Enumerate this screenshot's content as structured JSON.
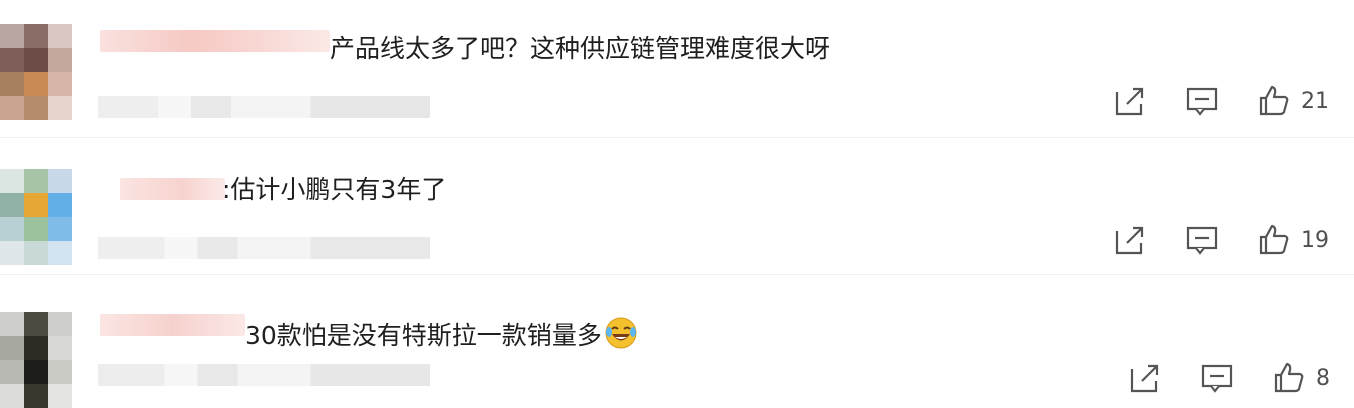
{
  "comments": [
    {
      "text": "产品线太多了吧？这种供应链管理难度很大呀",
      "likes": "21",
      "icons": [
        "share-icon",
        "reply-icon",
        "thumbs-up-icon"
      ],
      "avatar_palette": [
        "#b7a6a0",
        "#8a6d67",
        "#d9c6c2",
        "#7d5e58",
        "#6e4d48",
        "#c4a79d",
        "#a7805d",
        "#c98a55",
        "#d7b6a8",
        "#c9a58f",
        "#b68b6b",
        "#e6d5cd"
      ],
      "name_color": "#f7d2cf"
    },
    {
      "text": ":估计小鹏只有3年了",
      "likes": "19",
      "icons": [
        "share-icon",
        "reply-icon",
        "thumbs-up-icon"
      ],
      "avatar_palette": [
        "#dbe6e3",
        "#a7c5a6",
        "#c7d9e9",
        "#8fb1a6",
        "#e6a734",
        "#63aee6",
        "#b8cfd3",
        "#9cc29d",
        "#7fbde8",
        "#e0e7ea",
        "#c9d9d6",
        "#d2e4f1"
      ],
      "name_color": "#f7dad7"
    },
    {
      "text": "30款怕是没有特斯拉一款销量多",
      "likes": "8",
      "icons": [
        "share-icon",
        "reply-icon",
        "thumbs-up-icon"
      ],
      "emoji": "laughing-tears-emoji",
      "avatar_palette": [
        "#cfcfcb",
        "#4b4b40",
        "#cfcfcb",
        "#a7a8a0",
        "#2b2b24",
        "#d8d8d4",
        "#b9b9b3",
        "#1d1d19",
        "#cbcbc6",
        "#dcdcd8",
        "#38382f",
        "#e4e4e0"
      ],
      "name_color": "#f7d9d5"
    }
  ]
}
